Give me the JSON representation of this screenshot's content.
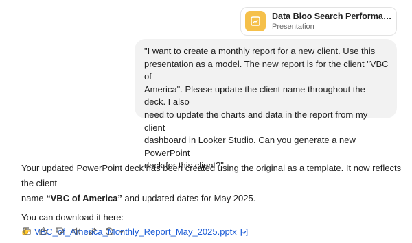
{
  "attachment": {
    "name": "Data Bloo Search Performance Rep...",
    "type": "Presentation",
    "icon": "presentation-file-icon",
    "icon_color": "#f5c04a"
  },
  "user_message": {
    "lines": [
      "\"I want to create a monthly report for a new client. Use this",
      "presentation as a model. The new report is for the client \"VBC of",
      "America\". Please update the client name throughout the deck. I also",
      "need to update the charts and data in the report from my client",
      "dashboard in Looker Studio. Can you generate a new PowerPoint",
      "deck for this client?\""
    ]
  },
  "assistant_message": {
    "line1": "Your updated PowerPoint deck has been created using the original as a template. It now reflects the client",
    "line2_pre": "name ",
    "client_name": "“VBC of America”",
    "line2_post": " and updated dates for May 2025.",
    "download_intro": "You can download it here:",
    "pointer": "👉",
    "file_link": "VBC_of_America_Monthly_Report_May_2025.pptx",
    "link_color": "#1a5bd6"
  },
  "action_bar": {
    "icons": [
      "copy-icon",
      "thumbs-up-icon",
      "thumbs-down-icon",
      "speaker-icon",
      "edit-icon",
      "regenerate-icon",
      "chevron-down-icon"
    ]
  }
}
